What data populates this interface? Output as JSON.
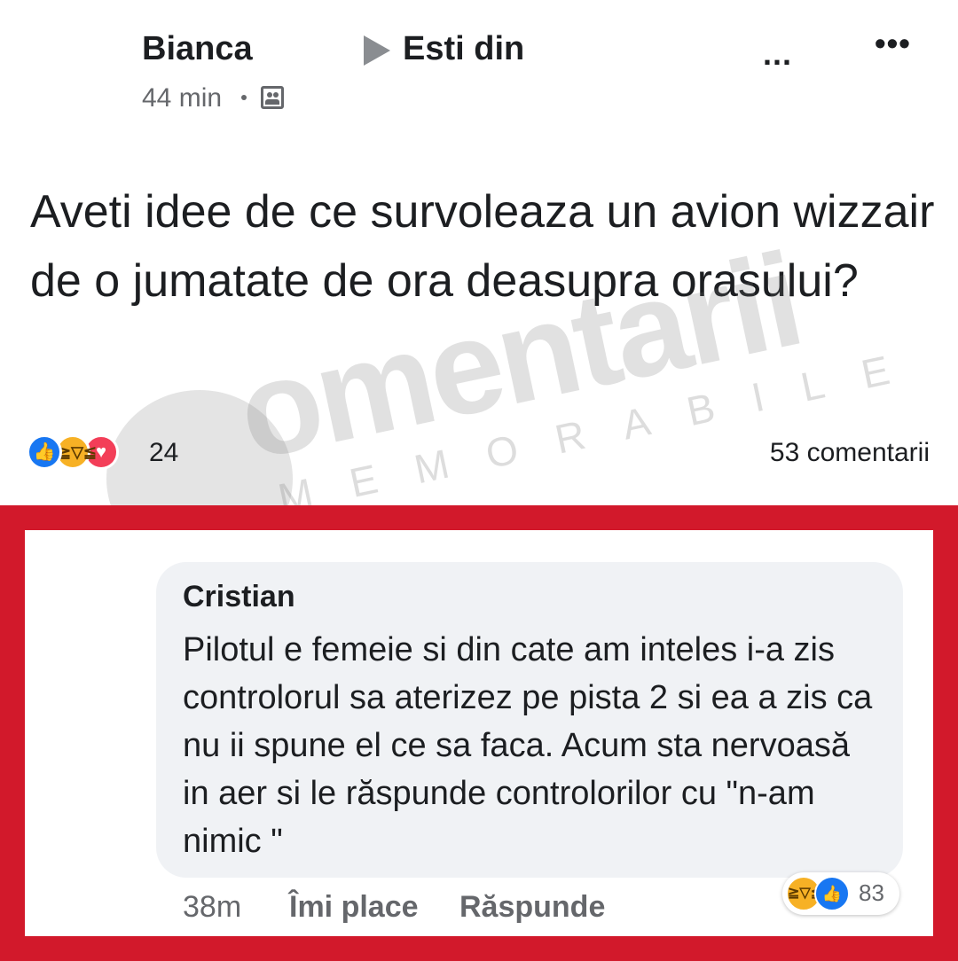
{
  "post": {
    "author": "Bianca",
    "group_name": "Esti din",
    "time": "44 min",
    "audience_icon": "group-icon",
    "more_a": "...",
    "more_b": "•••",
    "text": "Aveti idee de ce survoleaza un avion wizzair de o jumatate de ora deasupra orasului?",
    "reactions": {
      "icons": [
        "like-icon",
        "haha-icon",
        "love-icon"
      ],
      "count": "24"
    },
    "comments_count": "53 comentarii"
  },
  "watermark": {
    "text": "omentarii",
    "sub": "MEMORABILE"
  },
  "comment": {
    "author": "Cristian",
    "text": "Pilotul e femeie si din cate am inteles i-a zis controlorul sa aterizez pe pista 2 si ea a zis ca nu ii spune el ce sa faca. Acum sta nervoasă in aer si le răspunde controlorilor cu \"n-am nimic \"",
    "time": "38m",
    "like_label": "Îmi place",
    "reply_label": "Răspunde",
    "reactions": {
      "icons": [
        "haha-icon",
        "like-icon"
      ],
      "count": "83"
    }
  },
  "colors": {
    "highlight_border": "#d2192b",
    "like_blue": "#1877f2",
    "haha_yellow": "#f7b125",
    "love_red": "#f33e58",
    "bubble_bg": "#f0f2f5",
    "secondary_text": "#65676b"
  }
}
